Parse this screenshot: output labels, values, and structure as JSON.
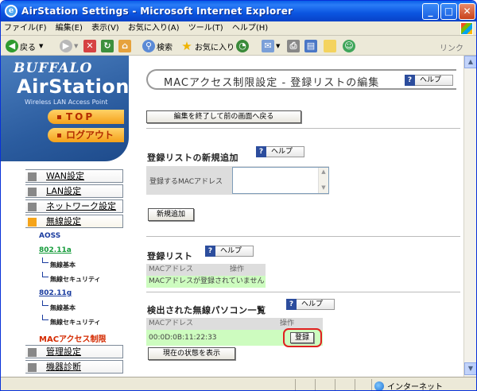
{
  "window": {
    "title": "AirStation Settings - Microsoft Internet Explorer",
    "min": "_",
    "max": "□",
    "close": "✕"
  },
  "menubar": [
    "ファイル(F)",
    "編集(E)",
    "表示(V)",
    "お気に入り(A)",
    "ツール(T)",
    "ヘルプ(H)"
  ],
  "toolbar": {
    "back": "戻る",
    "search": "検索",
    "favorites": "お気に入り",
    "links": "リンク"
  },
  "sidebar": {
    "brand": "BUFFALO",
    "product": "AirStation",
    "tagline": "Wireless LAN Access Point",
    "top_button": "TOP",
    "logout_button": "ログアウト",
    "nav": [
      {
        "label": "WAN設定"
      },
      {
        "label": "LAN設定"
      },
      {
        "label": "ネットワーク設定"
      },
      {
        "label": "無線設定"
      }
    ],
    "sub": {
      "aoss": "AOSS",
      "a11": "802.11a",
      "a_basic": "無線基本",
      "a_security": "無線セキュリティ",
      "g11": "802.11g",
      "g_basic": "無線基本",
      "g_security": "無線セキュリティ",
      "mac": "MACアクセス制限"
    },
    "nav2": [
      {
        "label": "管理設定"
      },
      {
        "label": "機器診断"
      }
    ]
  },
  "main": {
    "header_title": "MACアクセス制限設定 - 登録リストの編集",
    "help": "ヘルプ",
    "back_button": "編集を終了して前の画面へ戻る",
    "new_section": "登録リストの新規追加",
    "mac_input_label": "登録するMACアドレス",
    "mac_input_value": "",
    "add_button": "新規追加",
    "list_section": "登録リスト",
    "list_headers": [
      "MACアドレス",
      "操作"
    ],
    "list_empty": "MACアドレスが登録されていません",
    "detected_section": "検出された無線パソコン一覧",
    "detected_headers": [
      "MACアドレス",
      "操作"
    ],
    "detected_rows": [
      {
        "mac": "00:0D:0B:11:22:33",
        "action": "登録"
      }
    ],
    "refresh_button": "現在の状態を表示"
  },
  "statusbar": {
    "zone": "インターネット"
  }
}
